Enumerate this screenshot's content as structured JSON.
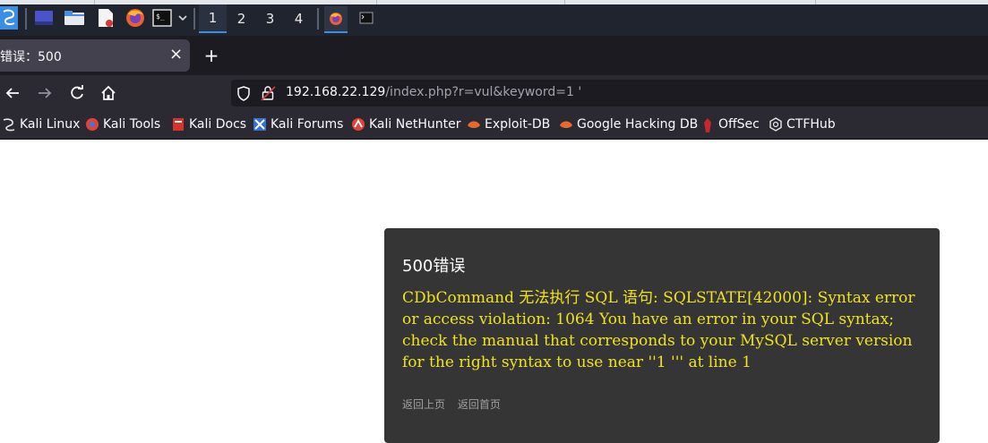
{
  "taskbar": {
    "workspaces": [
      "1",
      "2",
      "3",
      "4"
    ],
    "active_workspace": "1",
    "icons": [
      "kali-dragon-icon",
      "desktop-icon",
      "file-manager-icon",
      "text-editor-icon",
      "firefox-icon",
      "terminal-icon",
      "chevron-down-icon"
    ],
    "window_buttons": [
      "firefox-window-icon",
      "terminal-window-icon"
    ]
  },
  "browser": {
    "tab_title": "错误：500",
    "tab_close": "×",
    "new_tab": "+",
    "url_host": "192.168.22.129",
    "url_path": "/index.php?r=vul&keyword=1 '"
  },
  "bookmarks": [
    {
      "label": "Kali Linux",
      "icon": "kali-dragon-icon",
      "color": "#e8e8e8"
    },
    {
      "label": "Kali Tools",
      "icon": "kali-tools-icon",
      "color": "#e2413a"
    },
    {
      "label": "Kali Docs",
      "icon": "kali-docs-icon",
      "color": "#d8322b"
    },
    {
      "label": "Kali Forums",
      "icon": "kali-forums-icon",
      "color": "#3673d1"
    },
    {
      "label": "Kali NetHunter",
      "icon": "nethunter-icon",
      "color": "#e04436"
    },
    {
      "label": "Exploit-DB",
      "icon": "exploit-db-icon",
      "color": "#e8692d"
    },
    {
      "label": "Google Hacking DB",
      "icon": "ghdb-icon",
      "color": "#e8692d"
    },
    {
      "label": "OffSec",
      "icon": "offsec-icon",
      "color": "#c9252c"
    },
    {
      "label": "CTFHub",
      "icon": "ctfhub-icon",
      "color": "#e8e8e8"
    }
  ],
  "error": {
    "title": "500错误",
    "message": "CDbCommand 无法执行 SQL 语句: SQLSTATE[42000]: Syntax error or access violation: 1064 You have an error in your SQL syntax; check the manual that corresponds to your MySQL server version for the right syntax to use near ''1 ''' at line 1",
    "back_link": "返回上页",
    "home_link": "返回首页"
  },
  "colors": {
    "card_bg": "#353535",
    "message_color": "#f0e21e",
    "accent": "#3b8ee6"
  }
}
